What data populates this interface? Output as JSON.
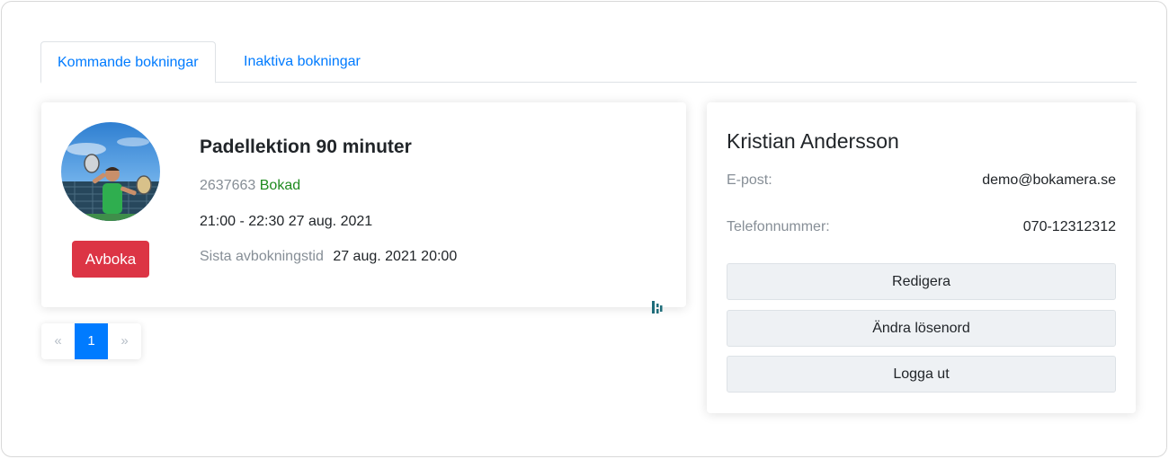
{
  "tabs": [
    {
      "label": "Kommande bokningar",
      "active": true
    },
    {
      "label": "Inaktiva bokningar",
      "active": false
    }
  ],
  "booking": {
    "title": "Padellektion 90 minuter",
    "id": "2637663",
    "status": "Bokad",
    "time": "21:00 - 22:30 27 aug. 2021",
    "deadline_label": "Sista avbokningstid",
    "deadline_value": "27 aug. 2021 20:00",
    "cancel_label": "Avboka"
  },
  "pagination": {
    "prev": "«",
    "current": "1",
    "next": "»"
  },
  "profile": {
    "name": "Kristian Andersson",
    "email_label": "E-post:",
    "email_value": "demo@bokamera.se",
    "phone_label": "Telefonnummer:",
    "phone_value": "070-12312312",
    "edit_label": "Redigera",
    "password_label": "Ändra lösenord",
    "logout_label": "Logga ut"
  },
  "colors": {
    "primary": "#007bff",
    "danger": "#dc3545",
    "success": "#1e8a1e",
    "muted": "#868e96"
  }
}
